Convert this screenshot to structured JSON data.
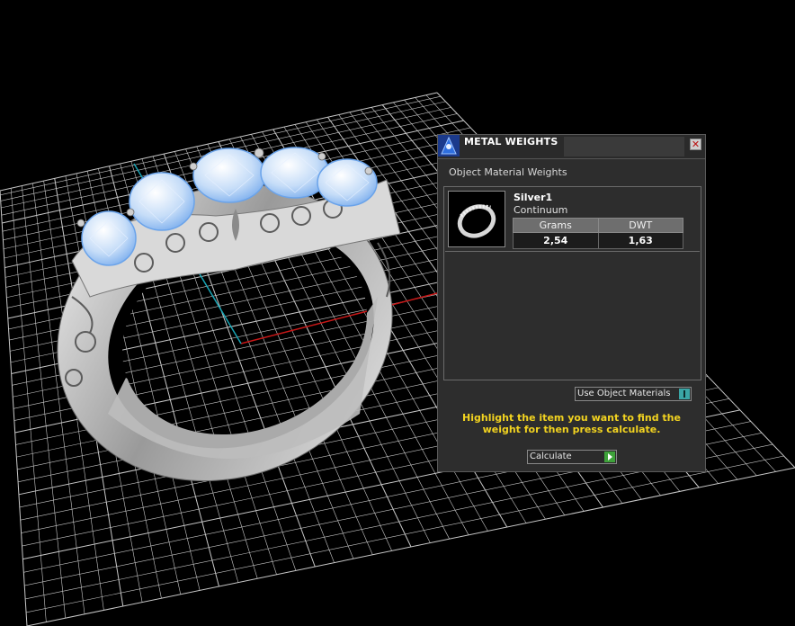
{
  "panel": {
    "title": "METAL WEIGHTS",
    "close_glyph": "✕",
    "section_label": "Object Material Weights",
    "material": {
      "name": "Silver1",
      "subtitle": "Continuum",
      "columns": [
        "Grams",
        "DWT"
      ],
      "values": [
        "2,54",
        "1,63"
      ]
    },
    "use_object_materials_label": "Use Object Materials",
    "hint": "Highlight the item you want to find the weight for then press calculate.",
    "calculate_label": "Calculate"
  },
  "icons": {
    "title": "metal-weights-icon",
    "close": "close-icon",
    "use_object": "info-icon",
    "calculate": "play-icon"
  },
  "colors": {
    "hint": "#f2d320",
    "accent_teal": "#3aa6a6",
    "accent_green": "#3ea23a",
    "axis_red": "#c81818",
    "axis_cyan": "#19a5b5",
    "grid": "#c8c8c8",
    "gem": "#a9cdf6"
  }
}
